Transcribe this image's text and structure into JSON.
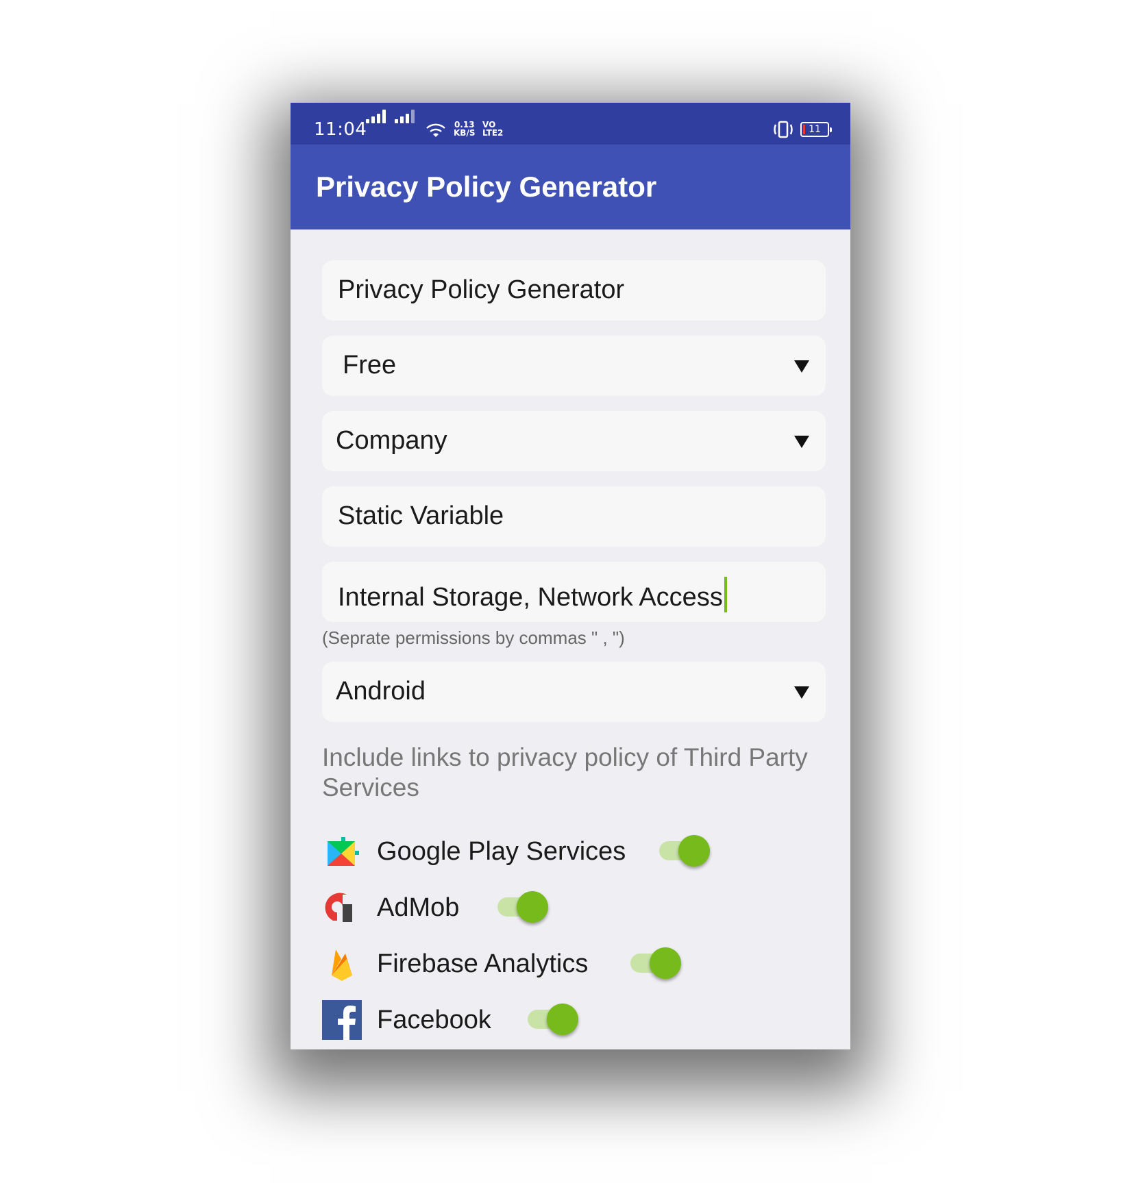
{
  "status_bar": {
    "time": "11:04",
    "net_speed_value": "0.13",
    "net_speed_unit": "KB/S",
    "volte_top": "VO",
    "volte_bottom": "LTE2",
    "battery_level": "11",
    "battery_color": "#e53935"
  },
  "app_bar": {
    "title": "Privacy Policy Generator",
    "color": "#3f51b5"
  },
  "form": {
    "app_name_value": "Privacy Policy Generator",
    "app_type_selected": "Free",
    "owner_type_selected": "Company",
    "owner_name_value": "Static Variable",
    "permissions_value": "Internal Storage, Network Access",
    "permissions_helper": "(Seprate permissions by commas \" , \")",
    "platform_selected": "Android"
  },
  "third_party": {
    "label": "Include links to privacy policy of Third Party Services",
    "services": [
      {
        "label": "Google Play Services",
        "icon": "google-play-services-icon",
        "enabled": true
      },
      {
        "label": "AdMob",
        "icon": "admob-icon",
        "enabled": true
      },
      {
        "label": "Firebase Analytics",
        "icon": "firebase-icon",
        "enabled": true
      },
      {
        "label": "Facebook",
        "icon": "facebook-icon",
        "enabled": true
      }
    ],
    "toggle_color": "#76bb1b"
  }
}
